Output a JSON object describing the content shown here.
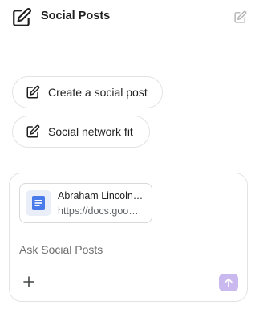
{
  "header": {
    "title": "Social Posts",
    "app_icon": "edit-square-icon",
    "new_chat_icon": "edit-square-icon"
  },
  "suggestions": [
    {
      "label": "Create a social post",
      "icon": "edit-square-icon"
    },
    {
      "label": "Social network fit",
      "icon": "edit-square-icon"
    }
  ],
  "composer": {
    "attachment": {
      "name": "Abraham Lincoln…",
      "url": "https://docs.goo…",
      "icon": "google-docs-icon"
    },
    "placeholder": "Ask Social Posts",
    "value": "",
    "add_icon": "plus-icon",
    "send_icon": "arrow-up-icon"
  },
  "colors": {
    "accent_disabled": "#c9b9ee",
    "docs_blue": "#4a7bea",
    "border": "#e3e3e3"
  }
}
